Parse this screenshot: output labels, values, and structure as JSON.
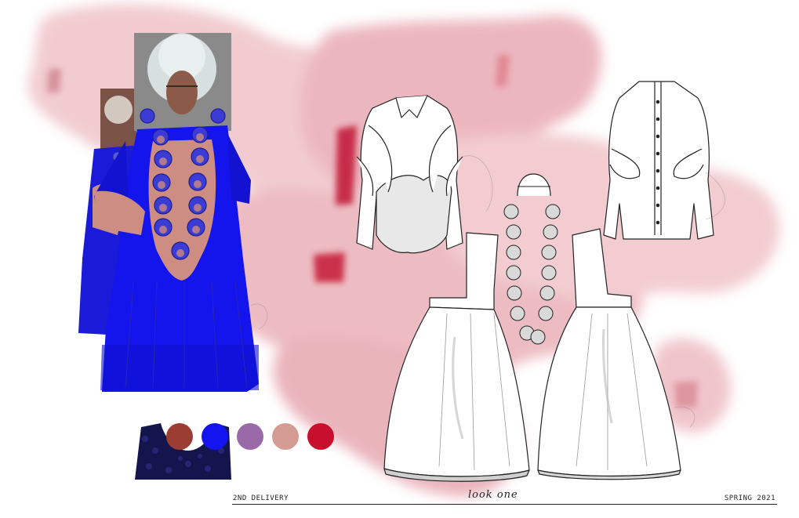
{
  "board": {
    "delivery_label": "2ND DELIVERY",
    "look_label": "look one",
    "season_label": "SPRING 2021"
  },
  "palette": {
    "swatches": [
      "#9c3d33",
      "#1414f0",
      "#9a6aa8",
      "#d49b93",
      "#c8102e"
    ]
  },
  "colors": {
    "watercolor": "#e6a4ad",
    "watercolor_dark": "#c21f3a",
    "garment_blue": "#1717e6",
    "garment_beige": "#cf8f84",
    "flat_line": "#222222",
    "skirt_hem": "#cfcfcf"
  }
}
